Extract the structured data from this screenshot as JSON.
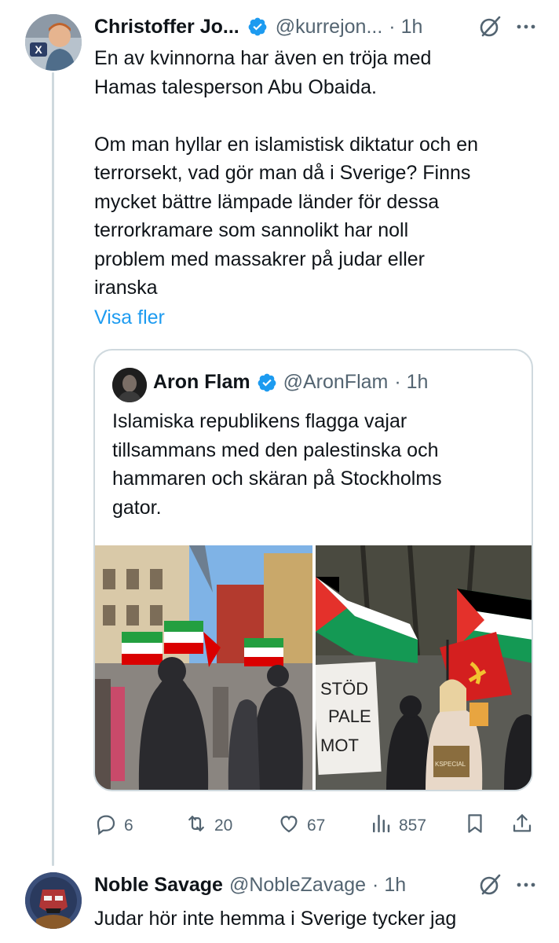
{
  "tweet1": {
    "name": "Christoffer Jo...",
    "handle": "@kurrejon...",
    "time": "· 1h",
    "text": "En av kvinnorna har även en tröja med\nHamas talesperson Abu Obaida.\n\nOm man hyllar en islamistisk diktatur och en\nterrorsekt, vad gör man då i Sverige? Finns\nmycket bättre lämpade länder för dessa\nterrorkramare som sannolikt har noll\nproblem med massakrer på judar eller\niranska",
    "show_more": "Visa fler",
    "quote": {
      "name": "Aron Flam",
      "handle": "@AronFlam",
      "time": "· 1h",
      "text": "Islamiska republikens flagga vajar\ntillsammans med den palestinska och\nhammaren och skäran på Stockholms\ngator.",
      "photo2_sign": "STÖD\nPALE\nMOT",
      "photo2_bag": "KSPECIAL"
    },
    "actions": {
      "replies": "6",
      "reposts": "20",
      "likes": "67",
      "views": "857"
    }
  },
  "tweet2": {
    "name": "Noble Savage",
    "handle": "@NobleZavage",
    "time": "· 1h",
    "text": "Judar hör inte hemma i Sverige tycker jag"
  },
  "colors": {
    "link": "#1d9bf0",
    "verified": "#1d9bf0",
    "muted": "#536471",
    "border": "#cfd9de"
  }
}
